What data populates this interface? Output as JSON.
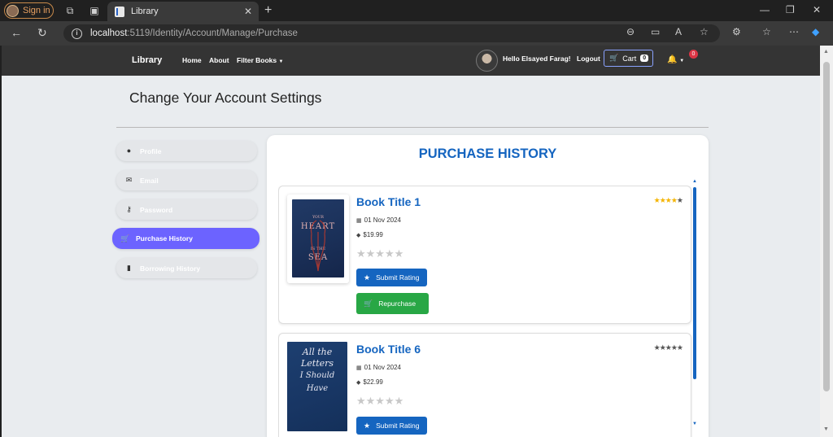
{
  "browser": {
    "signin_label": "Sign in",
    "tab_title": "Library",
    "url_host": "localhost",
    "url_path": ":5119/Identity/Account/Manage/Purchase"
  },
  "navbar": {
    "brand": "Library",
    "links": [
      "Home",
      "About",
      "Filter Books"
    ],
    "greeting": "Hello Elsayed Farag!",
    "logout": "Logout",
    "cart_label": "Cart",
    "cart_count": "0",
    "notification_count": "0"
  },
  "page": {
    "title": "Change Your Account Settings",
    "panel_heading": "PURCHASE HISTORY"
  },
  "sidebar": {
    "items": [
      {
        "label": "Profile",
        "icon": "user-circle-icon",
        "active": false
      },
      {
        "label": "Email",
        "icon": "envelope-icon",
        "active": false
      },
      {
        "label": "Password",
        "icon": "key-icon",
        "active": false
      },
      {
        "label": "Purchase History",
        "icon": "cart-icon",
        "active": true
      },
      {
        "label": "Borrowing History",
        "icon": "book-icon",
        "active": false
      }
    ]
  },
  "purchases": [
    {
      "title": "Book Title 1",
      "date": "01 Nov 2024",
      "price": "$19.99",
      "rating": 4,
      "rating_max": 5,
      "cover_title_lines": [
        "YOUR",
        "HEART",
        "IS THE",
        "SEA"
      ],
      "submit_label": "Submit Rating",
      "repurchase_label": "Repurchase"
    },
    {
      "title": "Book Title 6",
      "date": "01 Nov 2024",
      "price": "$22.99",
      "rating": 0,
      "rating_max": 5,
      "cover_title_lines": [
        "All the",
        "Letters",
        "I Should",
        "Have"
      ],
      "submit_label": "Submit Rating",
      "repurchase_label": ""
    }
  ]
}
